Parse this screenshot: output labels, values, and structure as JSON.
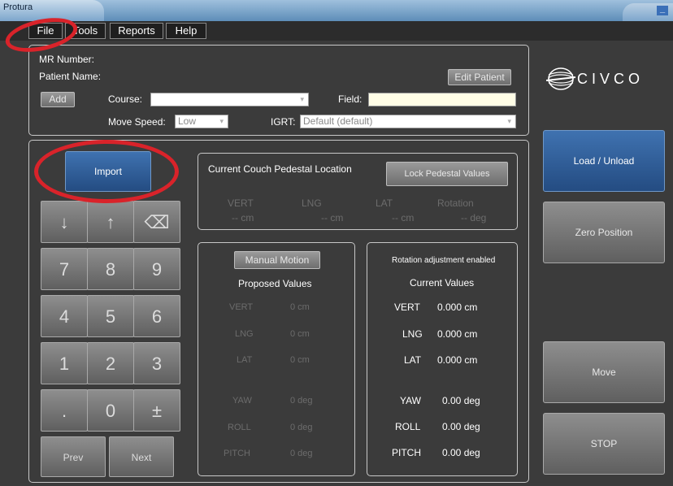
{
  "window": {
    "title": "Protura",
    "minimize_glyph": "_"
  },
  "menu": {
    "items": [
      "File",
      "Tools",
      "Reports",
      "Help"
    ]
  },
  "patient": {
    "mr_label": "MR Number:",
    "name_label": "Patient Name:",
    "edit_button": "Edit Patient",
    "add_button": "Add",
    "course_label": "Course:",
    "course_value": "",
    "field_label": "Field:",
    "field_value": "",
    "speed_label": "Move Speed:",
    "speed_value": "Low",
    "igrt_label": "IGRT:",
    "igrt_value": "Default (default)"
  },
  "logo": {
    "text": "CIVCO"
  },
  "controls": {
    "import_button": "Import",
    "prev_button": "Prev",
    "next_button": "Next"
  },
  "keypad": {
    "rows": [
      [
        "7",
        "8",
        "9"
      ],
      [
        "4",
        "5",
        "6"
      ],
      [
        "1",
        "2",
        "3"
      ],
      [
        ".",
        "0",
        "±"
      ]
    ],
    "down_arrow": "↓",
    "up_arrow": "↑",
    "backspace": "⌫"
  },
  "couch": {
    "title": "Current Couch Pedestal Location",
    "lock_button": "Lock Pedestal Values",
    "headers": [
      "VERT",
      "LNG",
      "LAT",
      "Rotation"
    ],
    "values": [
      "-- cm",
      "-- cm",
      "-- cm",
      "-- deg"
    ]
  },
  "proposed": {
    "manual_button": "Manual Motion",
    "title": "Proposed Values",
    "rows": [
      {
        "label": "VERT",
        "value": "0 cm"
      },
      {
        "label": "LNG",
        "value": "0 cm"
      },
      {
        "label": "LAT",
        "value": "0 cm"
      },
      {
        "label": "YAW",
        "value": "0 deg"
      },
      {
        "label": "ROLL",
        "value": "0 deg"
      },
      {
        "label": "PITCH",
        "value": "0 deg"
      }
    ]
  },
  "current": {
    "note": "Rotation adjustment enabled",
    "title": "Current Values",
    "rows": [
      {
        "label": "VERT",
        "value": "0.000  cm"
      },
      {
        "label": "LNG",
        "value": "0.000  cm"
      },
      {
        "label": "LAT",
        "value": "0.000  cm"
      },
      {
        "label": "YAW",
        "value": "0.00  deg"
      },
      {
        "label": "ROLL",
        "value": "0.00  deg"
      },
      {
        "label": "PITCH",
        "value": "0.00  deg"
      }
    ]
  },
  "side": {
    "load": "Load / Unload",
    "zero": "Zero Position",
    "move": "Move",
    "stop": "STOP"
  },
  "colors": {
    "accent_blue": "#2f5d97",
    "annotation_red": "#d9232a"
  }
}
